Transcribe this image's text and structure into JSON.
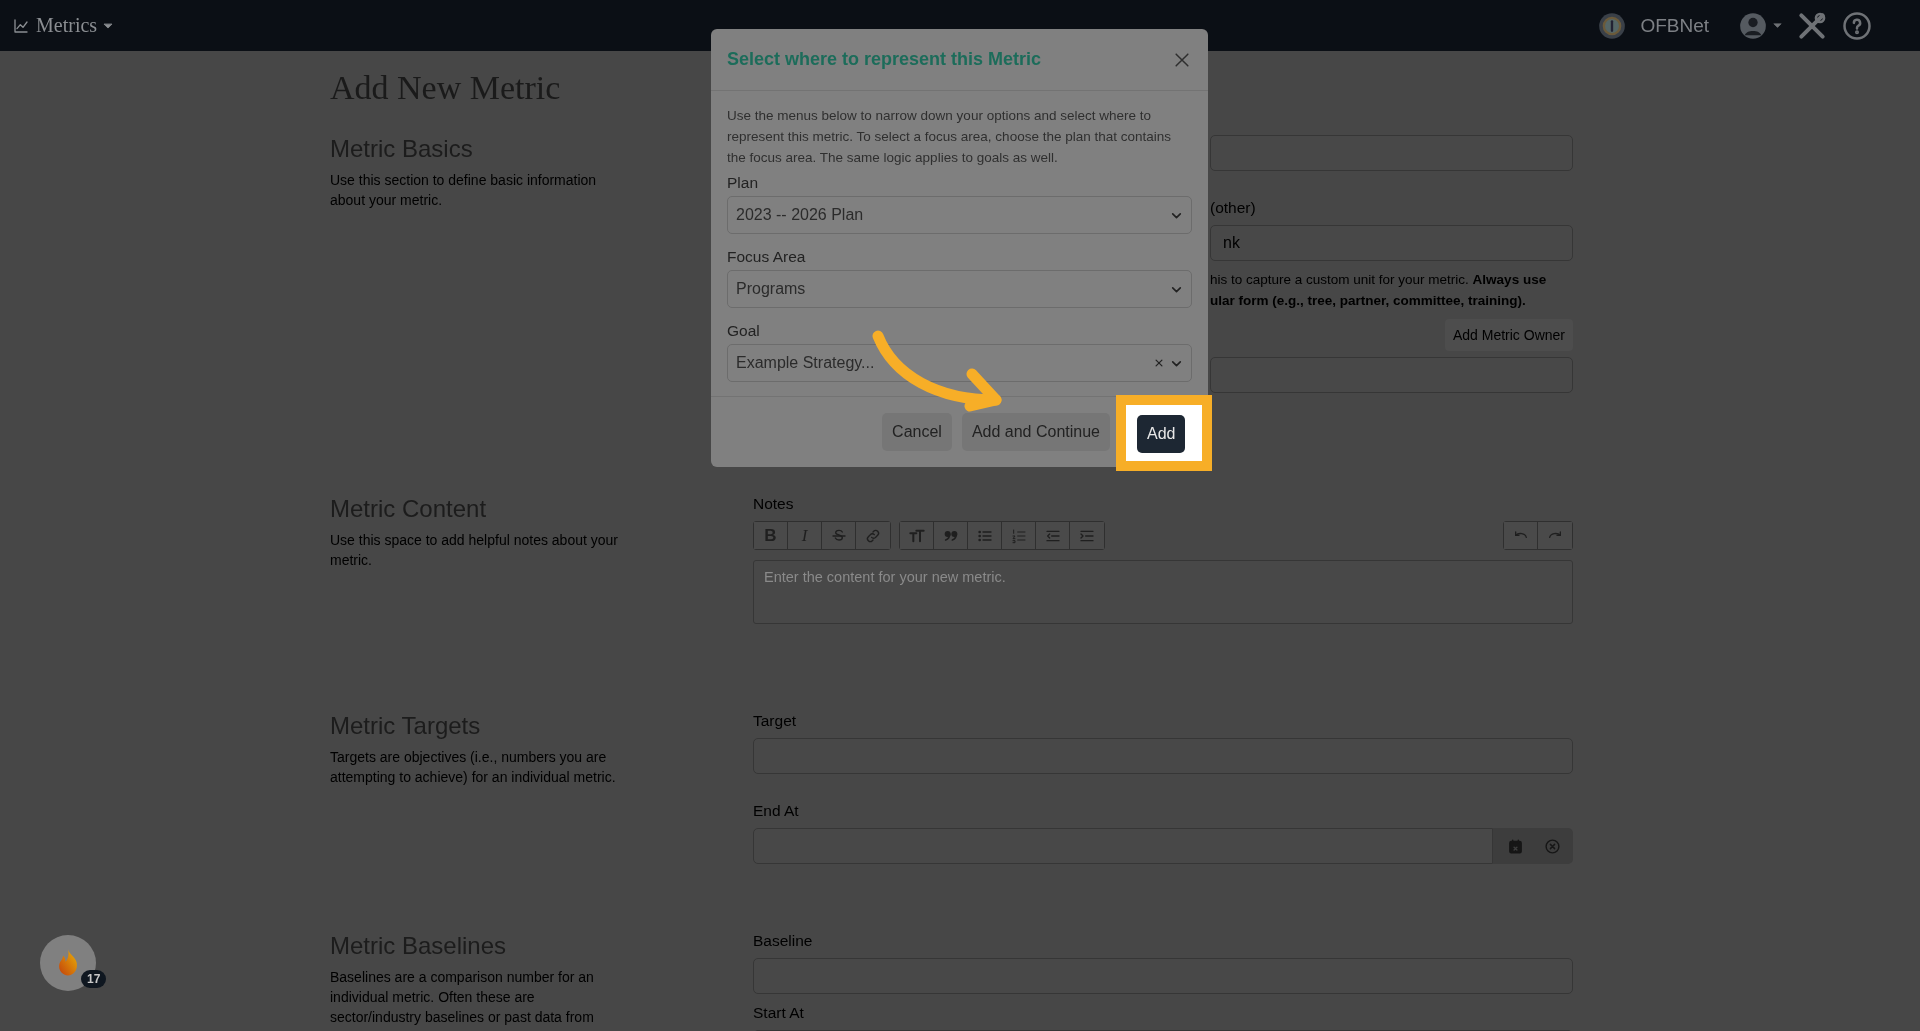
{
  "topbar": {
    "app_menu": "Metrics",
    "org": "OFBNet"
  },
  "page": {
    "title": "Add New Metric"
  },
  "sections": [
    {
      "kind": "basics",
      "title": "Metric Basics",
      "description": "Use this section to define basic information about your metric.",
      "unit_label": "(other)",
      "unit_value": "nk",
      "helper_lines": [
        {
          "text": "his to capture a custom unit for your metric. **Always use**",
          "bold": false
        },
        {
          "text": "ular form (e.g., tree, partner, committee, training).",
          "bold": true
        }
      ],
      "owner_button": "Add Metric Owner"
    },
    {
      "kind": "content",
      "title": "Metric Content",
      "description": "Use this space to add helpful notes about your metric.",
      "notes_label": "Notes",
      "toolbar": [
        [
          {
            "kind": "bold",
            "label": "B"
          },
          {
            "kind": "italic",
            "label": "I"
          },
          {
            "kind": "strike"
          },
          {
            "kind": "link"
          }
        ],
        [
          {
            "kind": "heading"
          },
          {
            "kind": "quote"
          },
          {
            "kind": "bullets"
          },
          {
            "kind": "numbers"
          },
          {
            "kind": "outdent"
          },
          {
            "kind": "indent"
          }
        ],
        [
          {
            "kind": "undo"
          },
          {
            "kind": "redo"
          }
        ]
      ],
      "placeholder": "Enter the content for your new metric."
    },
    {
      "kind": "targets",
      "title": "Metric Targets",
      "description": "Targets are objectives (i.e., numbers you are attempting to achieve) for an individual metric.",
      "fields": [
        {
          "label": "Target",
          "kind": "text"
        },
        {
          "label": "End At",
          "kind": "date"
        }
      ]
    },
    {
      "kind": "baselines",
      "title": "Metric Baselines",
      "description": "Baselines are a comparison number for an individual metric. Often these are sector/industry baselines or past data from",
      "fields": [
        {
          "label": "Baseline",
          "kind": "text"
        },
        {
          "label": "Start At",
          "kind": "text"
        }
      ]
    }
  ],
  "modal": {
    "title": "Select where to represent this Metric",
    "text": "Use the menus below to narrow down your options and select where to represent this metric. To select a focus area, choose the plan that contains the focus area. The same logic applies to goals as well.",
    "selects": [
      {
        "label": "Plan",
        "value": "2023 -- 2026 Plan",
        "clearable": false
      },
      {
        "label": "Focus Area",
        "value": "Programs",
        "clearable": false
      },
      {
        "label": "Goal",
        "value": "Example Strategy...",
        "clearable": true
      }
    ],
    "buttons": [
      {
        "label": "Cancel",
        "kind": "secondary"
      },
      {
        "label": "Add and Continue",
        "kind": "secondary"
      },
      {
        "label": "Add",
        "kind": "primary",
        "highlighted": true
      }
    ]
  },
  "notification_badge": {
    "count": "17"
  }
}
